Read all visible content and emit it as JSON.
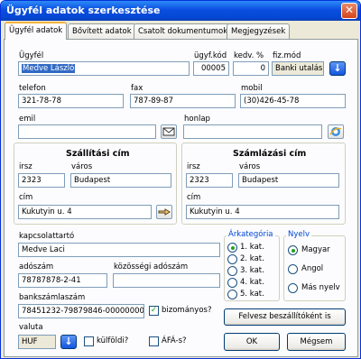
{
  "window": {
    "title": "Ügyfél adatok szerkesztése",
    "close_glyph": "✕"
  },
  "tabs": [
    {
      "label": "Ügyfél adatok",
      "active": true
    },
    {
      "label": "Bővített adatok",
      "active": false
    },
    {
      "label": "Csatolt dokumentumok",
      "active": false
    },
    {
      "label": "Megjegyzések",
      "active": false
    }
  ],
  "customer": {
    "name_label": "Ügyfél",
    "name_value": "Medve László",
    "code_label": "ügyf.kód",
    "code_value": "00005",
    "discount_label": "kedv. %",
    "discount_value": "0",
    "payment_label": "fiz.mód",
    "payment_value": "Banki utalás",
    "phone_label": "telefon",
    "phone_value": "321-78-78",
    "fax_label": "fax",
    "fax_value": "787-89-87",
    "mobile_label": "mobil",
    "mobile_value": "(30)426-45-78",
    "email_label": "emil",
    "email_value": "",
    "web_label": "honlap",
    "web_value": ""
  },
  "shipping": {
    "title": "Szállítási cím",
    "zip_label": "irsz",
    "zip_value": "2323",
    "city_label": "város",
    "city_value": "Budapest",
    "addr_label": "cím",
    "addr_value": "Kukutyin u. 4"
  },
  "billing": {
    "title": "Számlázási cím",
    "zip_label": "irsz",
    "zip_value": "2323",
    "city_label": "város",
    "city_value": "Budapest",
    "addr_label": "cím",
    "addr_value": "Kukutyin u. 4"
  },
  "contact": {
    "label": "kapcsolattartó",
    "value": "Medve Laci"
  },
  "tax": {
    "label": "adószám",
    "value": "78787878-2-41",
    "eu_label": "közösségi adószám",
    "eu_value": ""
  },
  "bank": {
    "label": "bankszámlaszám",
    "value": "78451232-79879846-00000000",
    "trusted_label": "bizományos?",
    "trusted": true
  },
  "currency": {
    "label": "valuta",
    "value": "HUF",
    "foreign_label": "külföldi?",
    "vat_label": "ÁFÁ-s?"
  },
  "price_category": {
    "legend": "Árkategória",
    "options": [
      "1. kat.",
      "2. kat.",
      "3. kat.",
      "4. kat.",
      "5. kat."
    ],
    "selected": "1. kat."
  },
  "language": {
    "legend": "Nyelv",
    "options": [
      "Magyar",
      "Angol",
      "Más nyelv"
    ],
    "selected": "Magyar"
  },
  "buttons": {
    "add_supplier": "Felvesz beszállítóként is",
    "ok": "OK",
    "cancel": "Mégsem"
  },
  "icons": {
    "payment_dropdown": "arrow-down-icon",
    "currency_dropdown": "arrow-down-icon",
    "email": "email-envelope-icon",
    "web": "internet-explorer-icon",
    "shipping_address": "pointing-hand-icon"
  },
  "colors": {
    "title_bar": "#0a4ee0",
    "selection": "#316ac5",
    "legend_text": "#0046d5"
  }
}
